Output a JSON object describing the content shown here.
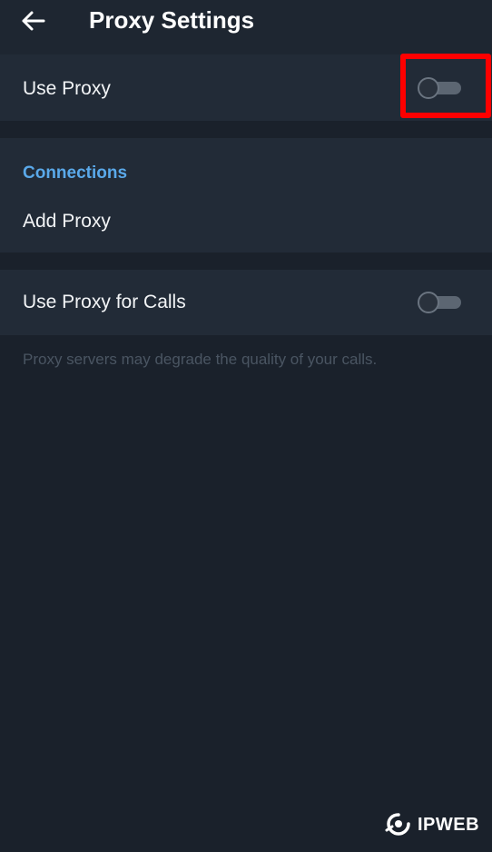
{
  "header": {
    "title": "Proxy Settings",
    "back_icon": "arrow-left-icon"
  },
  "use_proxy": {
    "label": "Use Proxy",
    "enabled": false
  },
  "connections": {
    "section_title": "Connections",
    "add_proxy_label": "Add Proxy"
  },
  "calls": {
    "label": "Use Proxy for Calls",
    "enabled": false,
    "info": "Proxy servers may degrade the quality of your calls."
  },
  "watermark": {
    "text": "IPWEB"
  },
  "colors": {
    "background": "#1a212b",
    "card": "#222b37",
    "accent": "#5aa9ea",
    "highlight": "#ff0000"
  }
}
